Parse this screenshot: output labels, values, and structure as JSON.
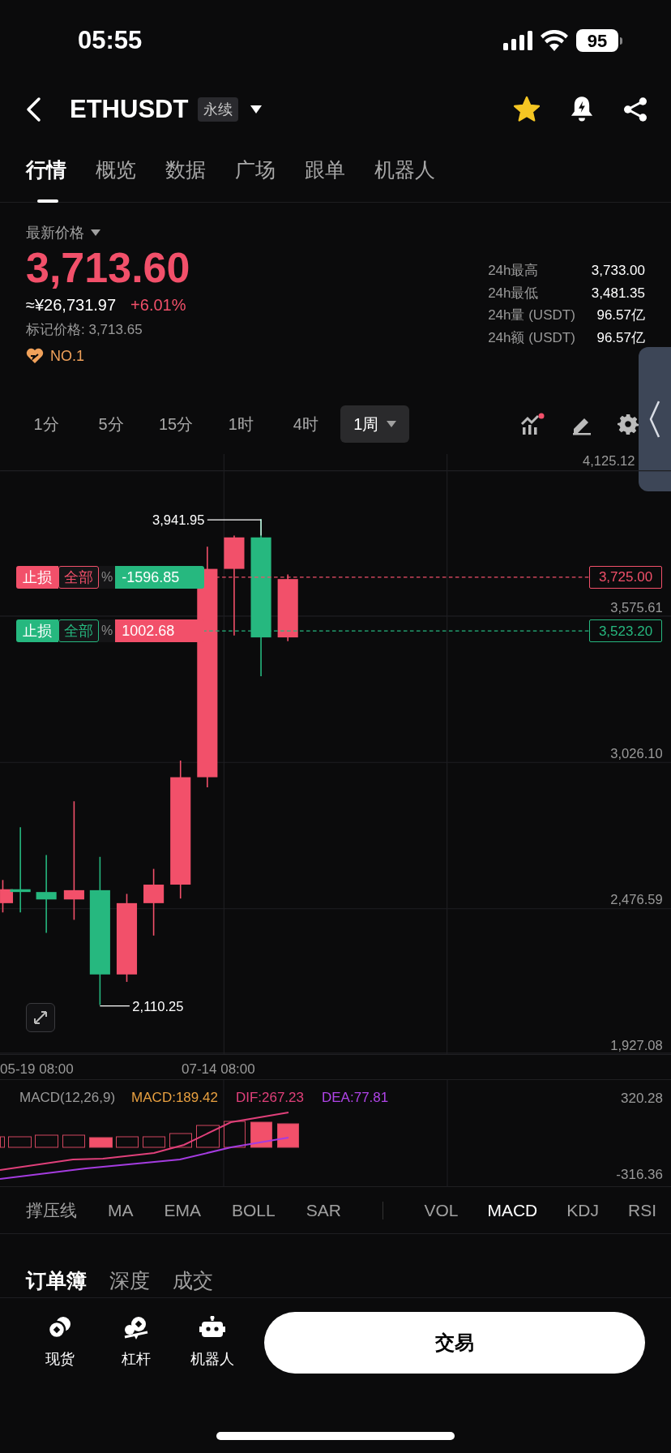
{
  "status_bar": {
    "time": "05:55",
    "battery": "95"
  },
  "header": {
    "symbol": "ETHUSDT",
    "badge": "永续",
    "favorite": true
  },
  "tabs": [
    {
      "label": "行情",
      "selected": true
    },
    {
      "label": "概览",
      "selected": false
    },
    {
      "label": "数据",
      "selected": false
    },
    {
      "label": "广场",
      "selected": false
    },
    {
      "label": "跟单",
      "selected": false
    },
    {
      "label": "机器人",
      "selected": false
    }
  ],
  "price": {
    "selector": "最新价格",
    "last": "3,713.60",
    "cny": "≈¥26,731.97",
    "change": "+6.01%",
    "mark": "标记价格: 3,713.65",
    "rank": "NO.1"
  },
  "stats": [
    {
      "label": "24h最高",
      "value": "3,733.00"
    },
    {
      "label": "24h最低",
      "value": "3,481.35"
    },
    {
      "label": "24h量 (USDT)",
      "value": "96.57亿"
    },
    {
      "label": "24h额 (USDT)",
      "value": "96.57亿"
    }
  ],
  "intervals": [
    {
      "label": "1分",
      "selected": false
    },
    {
      "label": "5分",
      "selected": false
    },
    {
      "label": "15分",
      "selected": false
    },
    {
      "label": "1时",
      "selected": false
    },
    {
      "label": "4时",
      "selected": false
    },
    {
      "label": "1周",
      "selected": true
    }
  ],
  "chart": {
    "price_axis": [
      "4,125.12",
      "3,575.61",
      "3,026.10",
      "2,476.59",
      "1,927.08"
    ],
    "high_label": "3,941.95",
    "low_label": "2,110.25",
    "orders": [
      {
        "label": "止损",
        "scope": "全部",
        "percent": "%",
        "pnl": "-1596.85",
        "price": "3,725.00",
        "color": "#f2506a",
        "profit": false
      },
      {
        "label": "止损",
        "scope": "全部",
        "percent": "%",
        "pnl": "1002.68",
        "price": "3,523.20",
        "color": "#26b87f",
        "profit": true
      }
    ],
    "time_axis": [
      "05-19 08:00",
      "07-14 08:00"
    ]
  },
  "macd": {
    "legend": "MACD(12,26,9)",
    "macd": "MACD:189.42",
    "dif": "DIF:267.23",
    "dea": "DEA:77.81",
    "axis": [
      "320.28",
      "-316.36"
    ]
  },
  "indicators": [
    {
      "label": "撑压线",
      "kind": "main",
      "selected": false
    },
    {
      "label": "MA",
      "kind": "main",
      "selected": false
    },
    {
      "label": "EMA",
      "kind": "main",
      "selected": false
    },
    {
      "label": "BOLL",
      "kind": "main",
      "selected": false
    },
    {
      "label": "SAR",
      "kind": "main",
      "selected": false
    },
    {
      "label": "VOL",
      "kind": "sub",
      "selected": false
    },
    {
      "label": "MACD",
      "kind": "sub",
      "selected": true
    },
    {
      "label": "KDJ",
      "kind": "sub",
      "selected": false
    },
    {
      "label": "RSI",
      "kind": "sub",
      "selected": false
    }
  ],
  "book_tabs": [
    {
      "label": "订单簿",
      "selected": true
    },
    {
      "label": "深度",
      "selected": false
    },
    {
      "label": "成交",
      "selected": false
    }
  ],
  "bottom_nav": [
    {
      "label": "现货",
      "kind": "spot"
    },
    {
      "label": "杠杆",
      "kind": "margin"
    },
    {
      "label": "机器人",
      "kind": "robot"
    }
  ],
  "trade_button": "交易"
}
